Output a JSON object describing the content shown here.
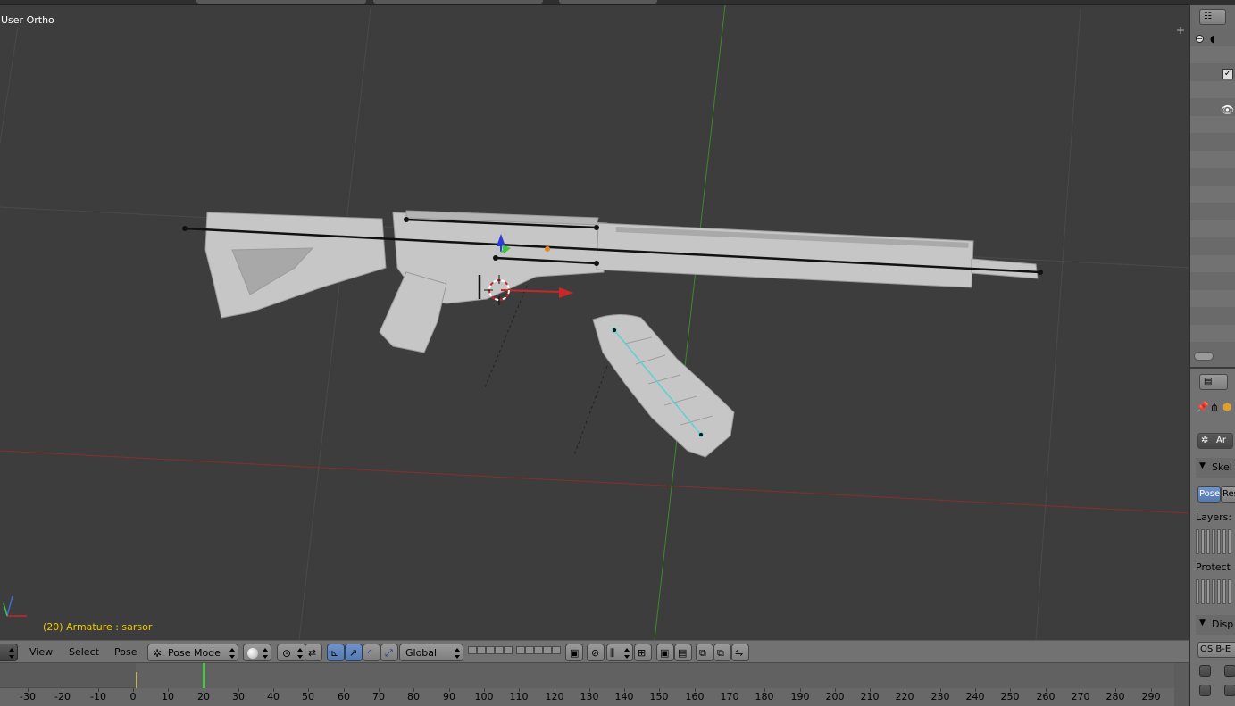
{
  "viewport": {
    "view_label": "User Ortho",
    "status_frame": "(20)",
    "status_object": "Armature : sarsor"
  },
  "header": {
    "menu_view": "View",
    "menu_select": "Select",
    "menu_pose": "Pose",
    "mode_label": "Pose Mode",
    "orientation_label": "Global"
  },
  "timeline": {
    "current_frame": 20,
    "start_frame": 0,
    "ticks": [
      "-30",
      "-20",
      "-10",
      "0",
      "10",
      "20",
      "30",
      "40",
      "50",
      "60",
      "70",
      "80",
      "90",
      "100",
      "110",
      "120",
      "130",
      "140",
      "150",
      "160",
      "170",
      "180",
      "190",
      "200",
      "210",
      "220",
      "230",
      "240",
      "250",
      "260",
      "270",
      "280",
      "290"
    ]
  },
  "properties": {
    "tab_label": "Ar",
    "panel_skeleton": "Skel",
    "btn_pose": "Pose",
    "btn_rest": "Res",
    "layers_label": "Layers:",
    "protected_label": "Protect",
    "panel_display": "Disp",
    "display_btns": "OS B-E"
  },
  "colors": {
    "viewport_bg": "#3d3d3d",
    "grid_line": "#4a4a4a",
    "x_axis": "#8a2d2d",
    "y_axis": "#3c8a2a",
    "mesh": "#c8c8c8",
    "status_text": "#f0c800",
    "selected_bone": "#5fd0d0",
    "accent": "#5679b0"
  }
}
